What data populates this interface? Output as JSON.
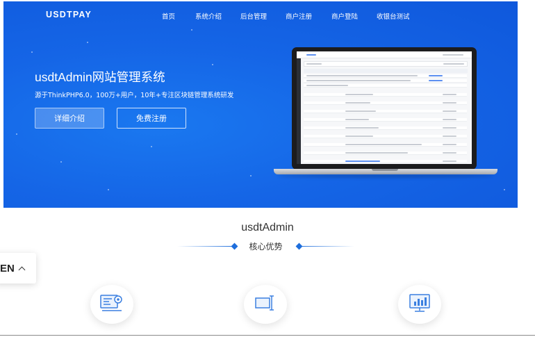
{
  "header": {
    "logo": "USDTPAY",
    "nav": [
      {
        "label": "首页"
      },
      {
        "label": "系统介绍"
      },
      {
        "label": "后台管理"
      },
      {
        "label": "商户注册"
      },
      {
        "label": "商户登陆"
      },
      {
        "label": "收银台测试"
      }
    ]
  },
  "hero": {
    "title": "usdtAdmin网站管理系统",
    "subtitle": "源于ThinkPHP6.0，100万+用户，10年+专注区块链管理系统研发",
    "detail_button": "详细介绍",
    "register_button": "免费注册"
  },
  "section": {
    "title": "usdtAdmin",
    "subtitle": "核心优势"
  },
  "language": {
    "label": "EN"
  },
  "features": [
    {
      "icon": "code-settings-icon"
    },
    {
      "icon": "text-cursor-icon"
    },
    {
      "icon": "monitor-chart-icon"
    }
  ],
  "colors": {
    "hero_bg": "#1565e6",
    "accent": "#1e6edc",
    "icon_blue": "#3a7fe0"
  }
}
